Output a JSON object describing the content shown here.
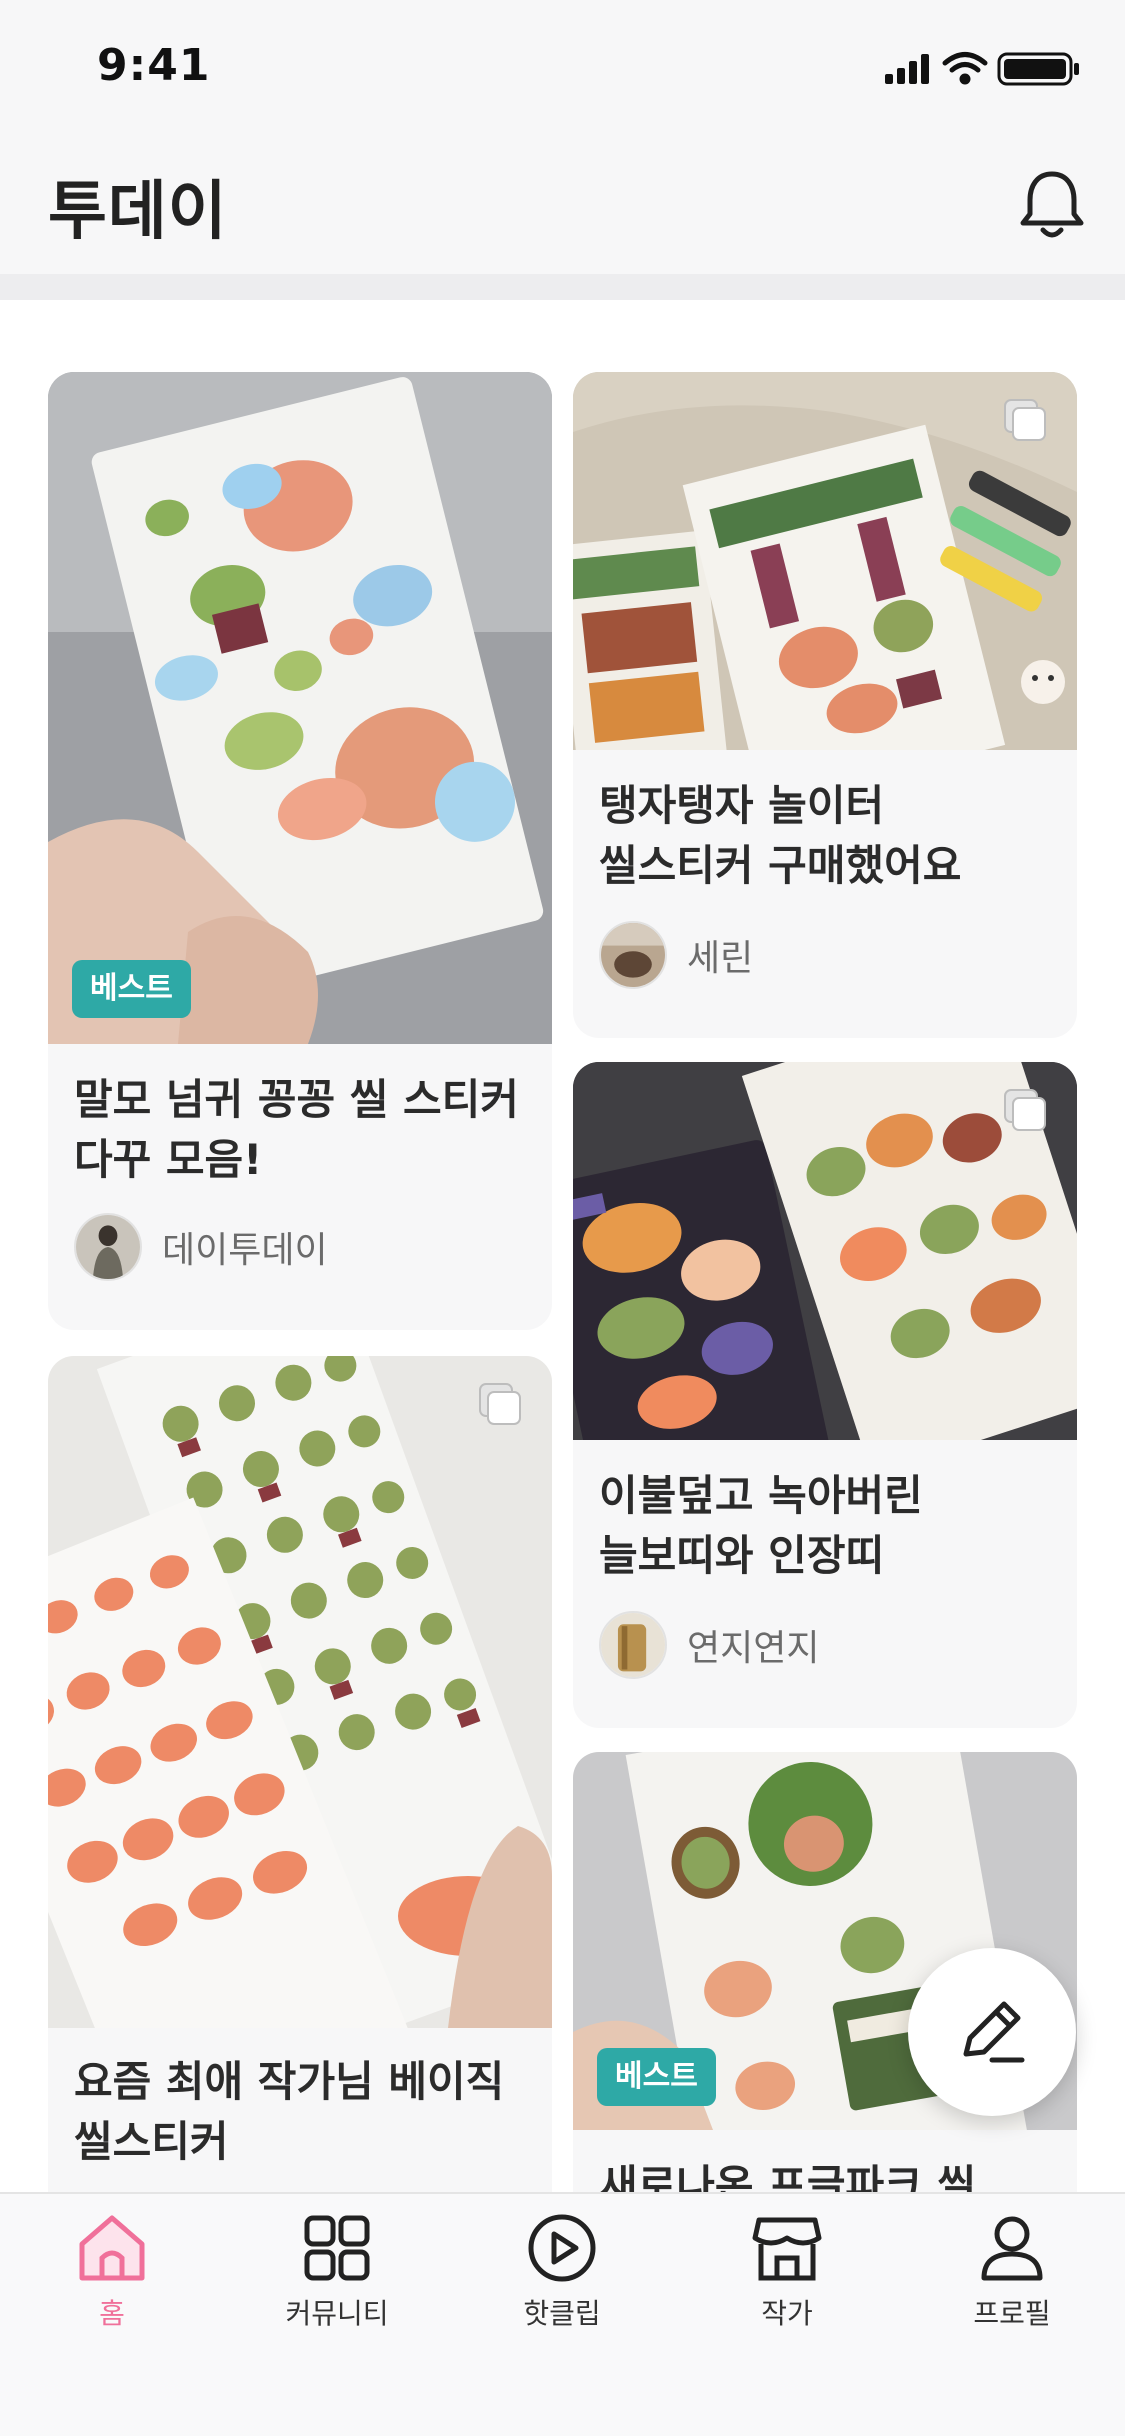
{
  "status_bar": {
    "time": "9:41"
  },
  "header": {
    "title": "투데이"
  },
  "feed": {
    "cards": [
      {
        "title": "말모 넘귀 꽁꽁 씰 스티커 다꾸 모음!",
        "author": "데이투데이",
        "badge": "베스트"
      },
      {
        "title": "요즘 최애 작가님 베이직 씰스티커",
        "author": ""
      },
      {
        "title": "탱자탱자 놀이터 씰스티커 구매했어요",
        "author": "세린"
      },
      {
        "title": "이불덮고 녹아버린 늘보띠와 인장띠",
        "author": "연지연지"
      },
      {
        "title": "새로나온 프글파크 씰 스티",
        "badge": "베스트"
      }
    ]
  },
  "bottom_nav": {
    "items": [
      {
        "label": "홈",
        "icon": "home-icon",
        "active": true
      },
      {
        "label": "커뮤니티",
        "icon": "grid-icon"
      },
      {
        "label": "핫클립",
        "icon": "play-circle-icon"
      },
      {
        "label": "작가",
        "icon": "shop-icon"
      },
      {
        "label": "프로필",
        "icon": "person-icon"
      }
    ]
  },
  "colors": {
    "accent": "#f0709a",
    "badge": "#2ea9a6",
    "background": "#f7f7f8"
  }
}
